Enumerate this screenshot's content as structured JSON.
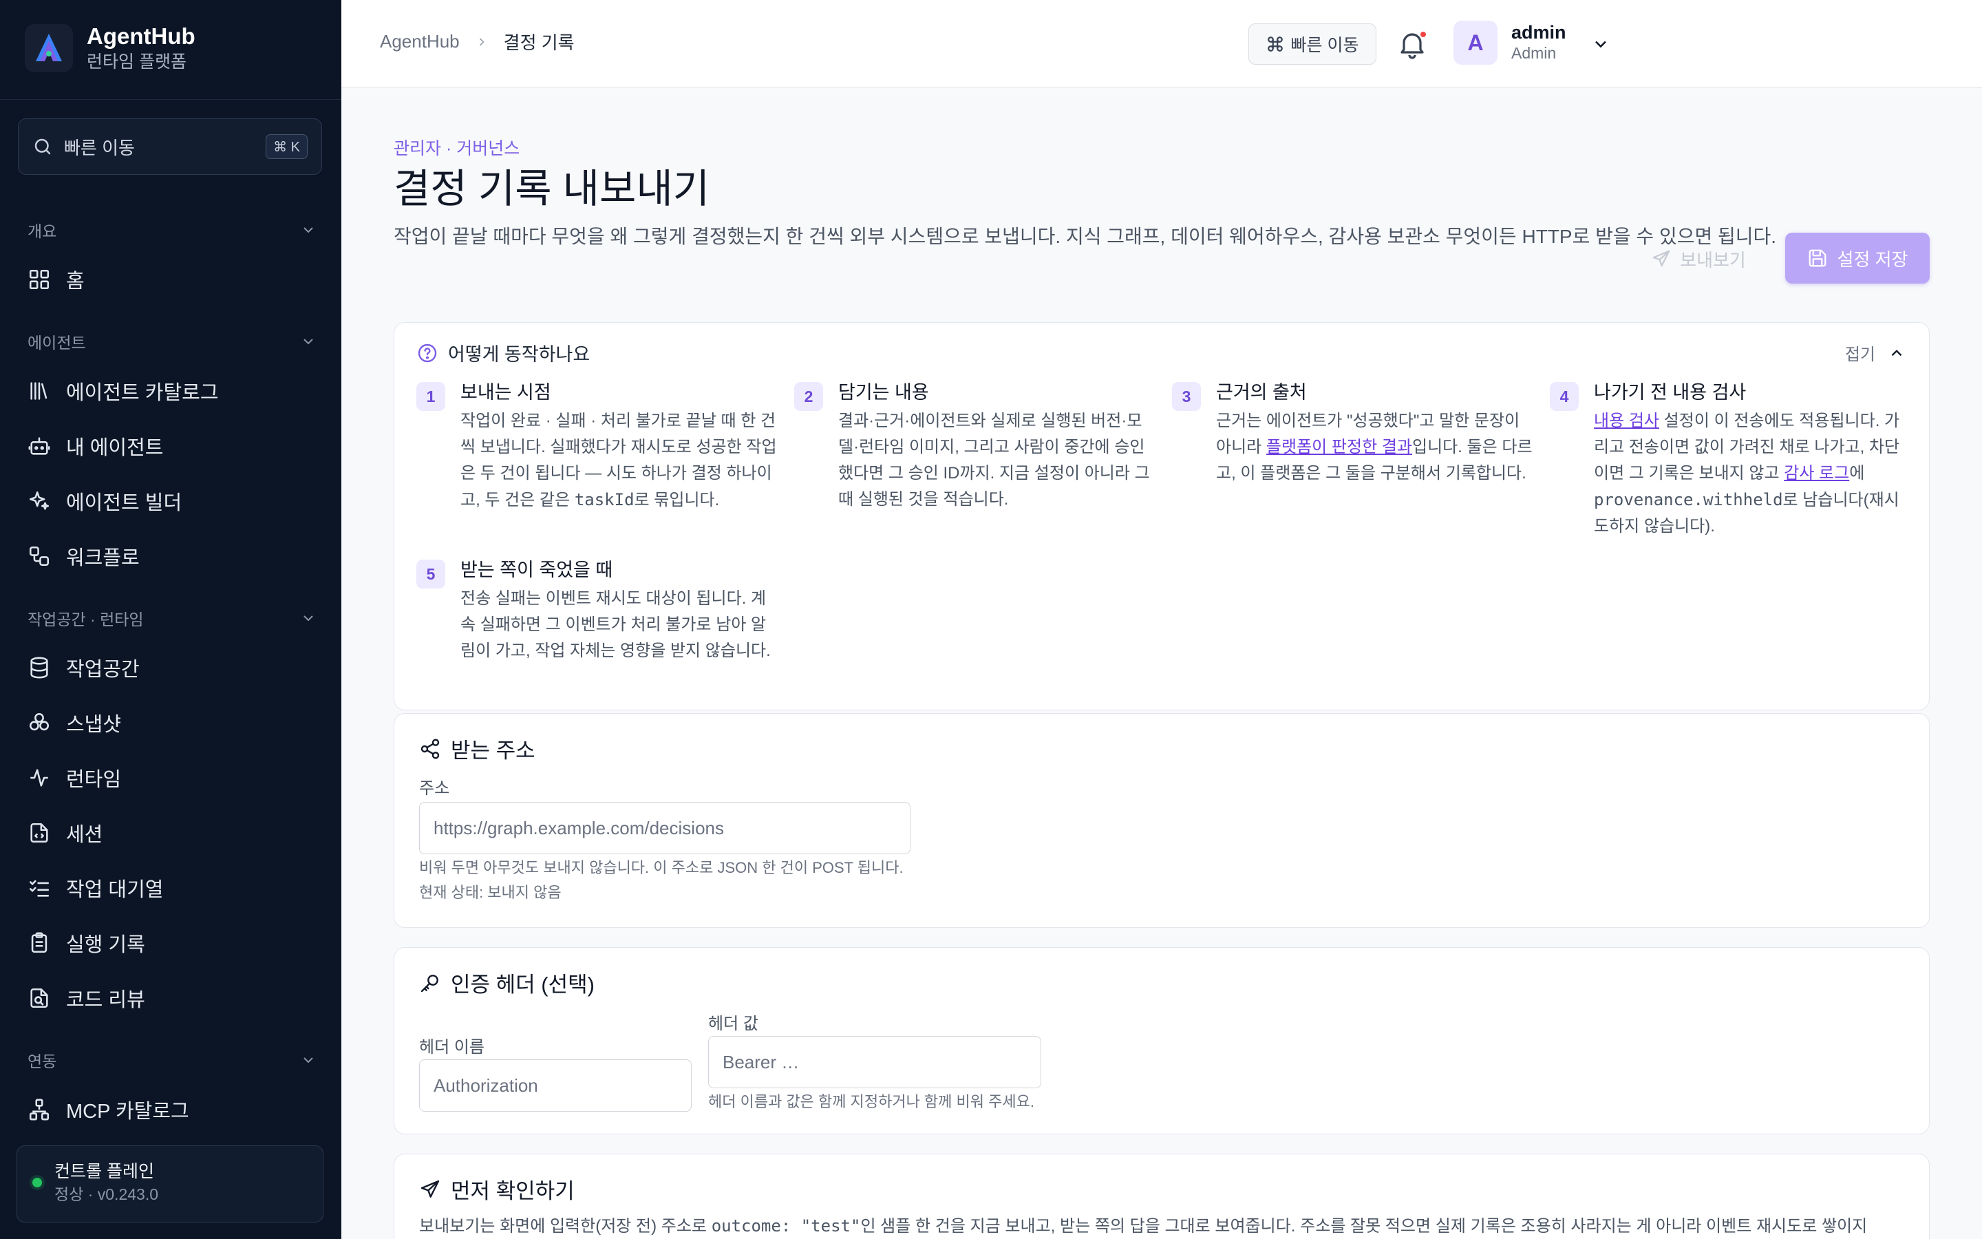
{
  "sidebar": {
    "brand": {
      "name": "AgentHub",
      "subtitle": "런타임 플랫폼"
    },
    "search": {
      "label": "빠른 이동",
      "shortcut": "⌘ K"
    },
    "sections": [
      {
        "title": "개요"
      },
      {
        "title": "에이전트"
      },
      {
        "title": "작업공간 · 런타임"
      },
      {
        "title": "연동"
      }
    ],
    "items": {
      "home": "홈",
      "agent_catalog": "에이전트 카탈로그",
      "my_agents": "내 에이전트",
      "agent_builder": "에이전트 빌더",
      "workflow": "워크플로",
      "workspace": "작업공간",
      "snapshot": "스냅샷",
      "runtime": "런타임",
      "session": "세션",
      "task_queue": "작업 대기열",
      "run_log": "실행 기록",
      "code_review": "코드 리뷰",
      "mcp_catalog": "MCP 카탈로그"
    },
    "status": {
      "title": "컨트롤 플레인",
      "detail": "정상 · v0.243.0",
      "color": "#22c55e"
    }
  },
  "topbar": {
    "breadcrumb": {
      "root": "AgentHub",
      "current": "결정 기록"
    },
    "quick_nav": "빠른 이동",
    "user": {
      "initial": "A",
      "name": "admin",
      "role": "Admin"
    }
  },
  "header": {
    "kicker": "관리자 · 거버넌스",
    "title": "결정 기록 내보내기",
    "description": "작업이 끝날 때마다 무엇을 왜 그렇게 결정했는지 한 건씩 외부 시스템으로 보냅니다. 지식 그래프, 데이터 웨어하우스, 감사용 보관소 무엇이든 HTTP로 받을 수 있으면 됩니다.",
    "preview_button": "보내보기",
    "save_button": "설정 저장"
  },
  "how": {
    "title": "어떻게 동작하나요",
    "collapse": "접기",
    "steps": [
      {
        "num": "1",
        "title": "보내는 시점",
        "body_a": "작업이 완료 · 실패 · 처리 불가로 끝날 때 한 건씩 보냅니다. 실패했다가 재시도로 성공한 작업은 두 건이 됩니다 — 시도 하나가 결정 하나이고, 두 건은 같은 ",
        "code": "taskId",
        "body_b": "로 묶입니다."
      },
      {
        "num": "2",
        "title": "담기는 내용",
        "body": "결과·근거·에이전트와 실제로 실행된 버전·모델·런타임 이미지, 그리고 사람이 중간에 승인했다면 그 승인 ID까지. 지금 설정이 아니라 그때 실행된 것을 적습니다."
      },
      {
        "num": "3",
        "title": "근거의 출처",
        "body_a": "근거는 에이전트가 \"성공했다\"고 말한 문장이 아니라 ",
        "link": "플랫폼이 판정한 결과",
        "body_b": "입니다. 둘은 다르고, 이 플랫폼은 그 둘을 구분해서 기록합니다."
      },
      {
        "num": "4",
        "title": "나가기 전 내용 검사",
        "link1": "내용 검사",
        "body_a": " 설정이 이 전송에도 적용됩니다. 가리고 전송이면 값이 가려진 채로 나가고, 차단이면 그 기록은 보내지 않고 ",
        "link2": "감사 로그",
        "body_b": "에 ",
        "code": "provenance.withheld",
        "body_c": "로 남습니다(재시도하지 않습니다)."
      },
      {
        "num": "5",
        "title": "받는 쪽이 죽었을 때",
        "body": "전송 실패는 이벤트 재시도 대상이 됩니다. 계속 실패하면 그 이벤트가 처리 불가로 남아 알림이 가고, 작업 자체는 영향을 받지 않습니다."
      }
    ]
  },
  "endpoint": {
    "title": "받는 주소",
    "label": "주소",
    "placeholder": "https://graph.example.com/decisions",
    "hint": "비워 두면 아무것도 보내지 않습니다. 이 주소로 JSON 한 건이 POST 됩니다.",
    "status": "현재 상태: 보내지 않음"
  },
  "auth": {
    "title": "인증 헤더 (선택)",
    "name_label": "헤더 이름",
    "name_placeholder": "Authorization",
    "value_label": "헤더 값",
    "value_placeholder": "Bearer …",
    "hint": "헤더 이름과 값은 함께 지정하거나 함께 비워 주세요."
  },
  "check": {
    "title": "먼저 확인하기",
    "desc_a": "보내보기는 화면에 입력한(저장 전) 주소로 ",
    "code": "outcome: \"test\"",
    "desc_b": "인 샘플 한 건을 지금 보내고, 받는 쪽의 답을 그대로 보여줍니다. 주소를 잘못 적으면 실제 기록은 조용히 사라지는 게 아니라 이벤트 재시도로 쌓이지"
  },
  "colors": {
    "accent": "#7c5fe6",
    "sidebar_bg": "#0c1525",
    "save_button": "#b9a6f6"
  }
}
